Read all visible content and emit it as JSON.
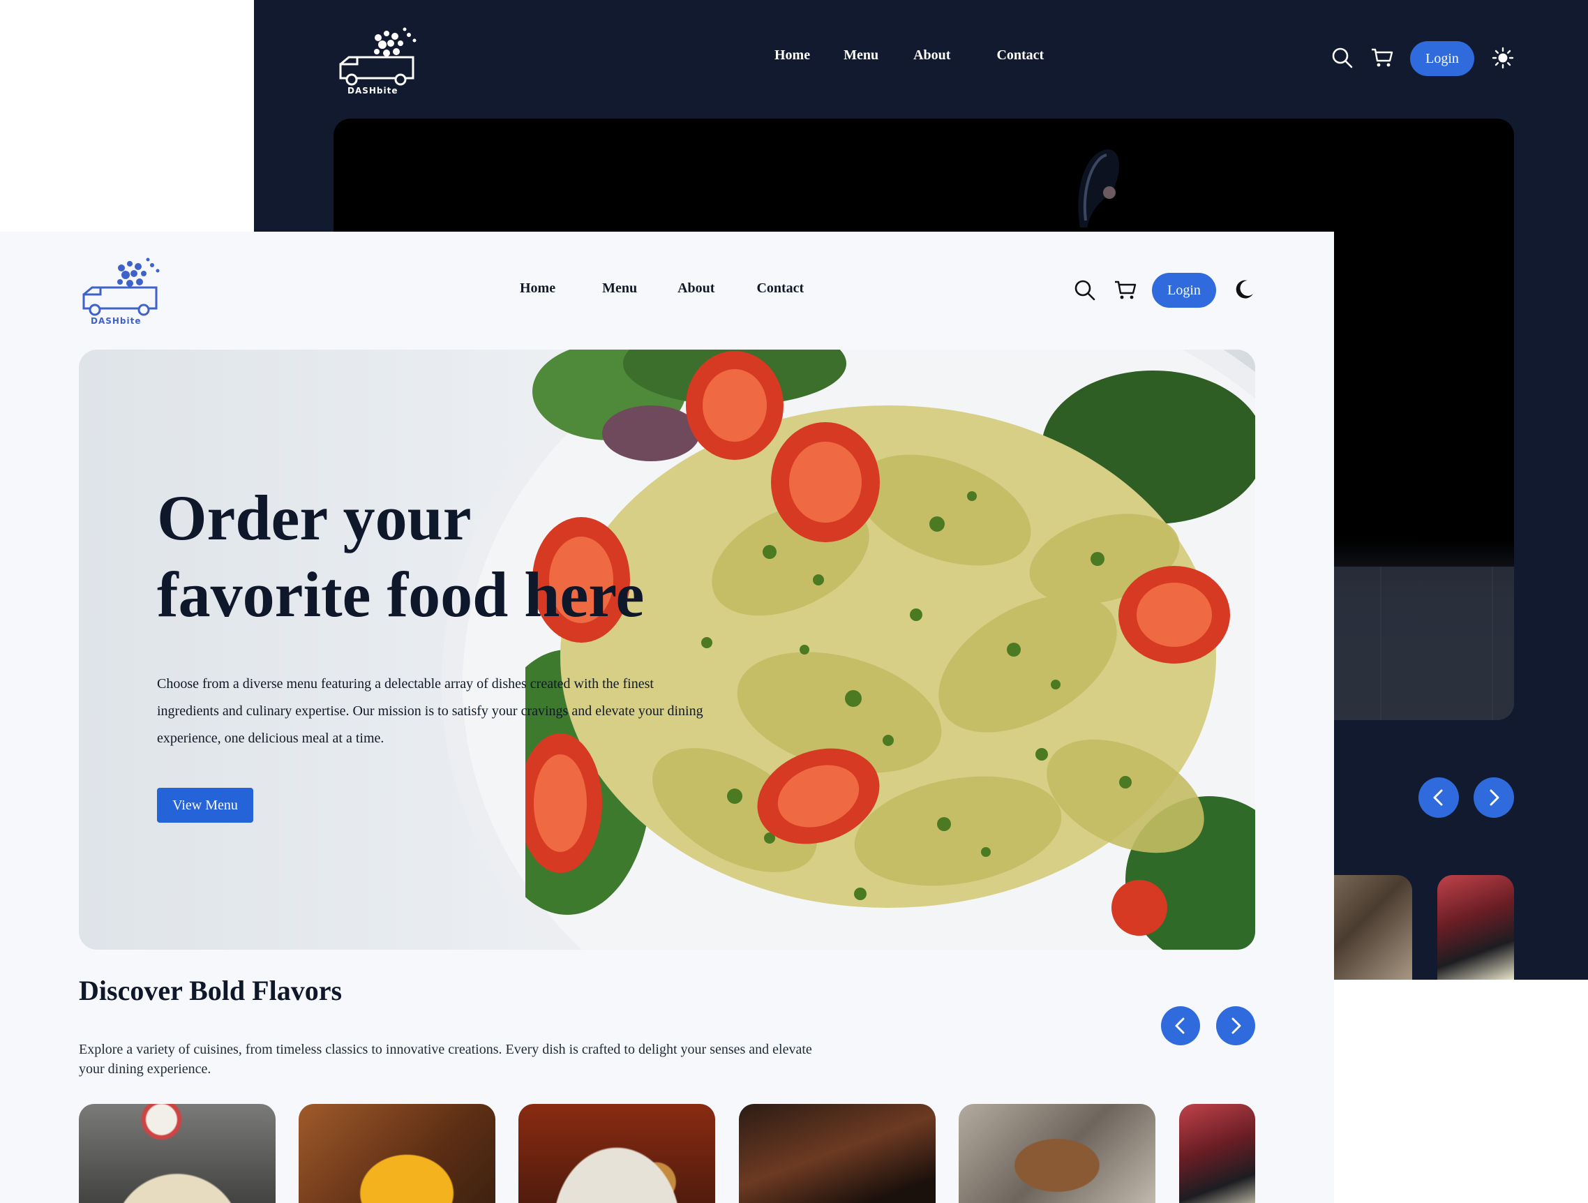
{
  "brand": {
    "name": "DASHbite"
  },
  "nav": {
    "home": "Home",
    "menu": "Menu",
    "about": "About",
    "contact": "Contact"
  },
  "header": {
    "login_label": "Login"
  },
  "hero": {
    "title_line1": "Order your",
    "title_line2": "favorite food here",
    "description": "Choose from a diverse menu featuring a delectable array of dishes created with the finest ingredients and culinary expertise. Our mission is to satisfy your cravings and elevate your dining experience, one delicious meal at a time.",
    "cta_label": "View Menu"
  },
  "section": {
    "title": "Discover Bold Flavors",
    "description": "Explore a variety of cuisines, from timeless classics to innovative creations. Every dish is crafted to delight your senses and elevate your dining experience."
  },
  "colors": {
    "accent": "#2563d8",
    "dark_bg": "#111a2e",
    "light_bg": "#f6f8fb",
    "text_dark": "#0f172a"
  },
  "icons": {
    "search": "search-icon",
    "cart": "cart-icon",
    "theme_light": "sun-icon",
    "theme_dark": "moon-icon",
    "prev": "chevron-left-icon",
    "next": "chevron-right-icon"
  }
}
